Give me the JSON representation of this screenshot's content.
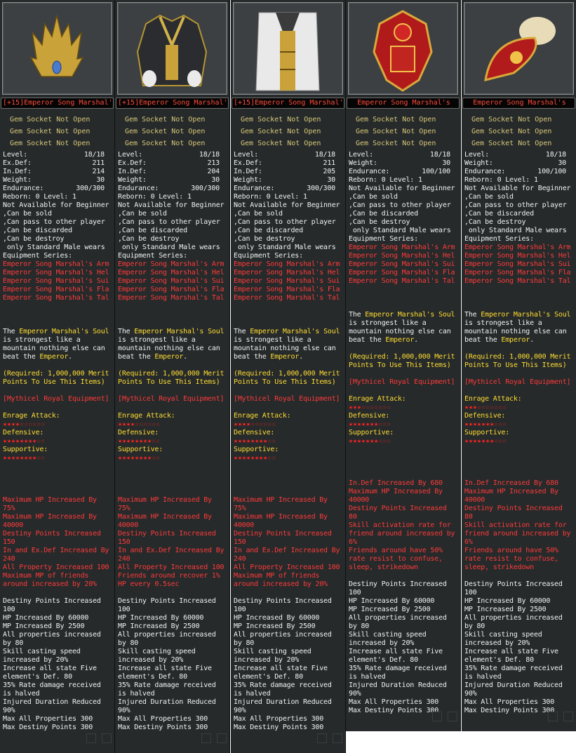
{
  "panels": [
    {
      "title": "[+15]Emperor Song Marshal's",
      "art_icon": "crown-icon",
      "gems": [
        "Gem Socket Not Open",
        "Gem Socket Not Open",
        "Gem Socket Not Open"
      ],
      "stats": [
        {
          "k": "Level:",
          "v": "18/18"
        },
        {
          "k": "Ex.Def:",
          "v": "211"
        },
        {
          "k": "In.Def:",
          "v": "214"
        },
        {
          "k": "Weight:",
          "v": "30"
        },
        {
          "k": "Endurance:",
          "v": "300/300"
        }
      ],
      "reborn": "Reborn: 0 Level: 1",
      "not_available": "Not Available for Beginner",
      "can_lines": [
        ",Can be sold",
        ",Can pass to other player",
        ",Can be discarded",
        ",Can be destroy",
        " only Standard Male wears"
      ],
      "series_label": "Equipment Series:",
      "series": [
        "Emperor Song Marshal's Arm",
        "Emperor Song Marshal's Hel",
        "Emperor Song Marshal's Sui",
        "Emperor Song Marshal's Fla",
        "Emperor Song Marshal's Tal"
      ],
      "desc": [
        {
          "t": "The ",
          "c": "w"
        },
        {
          "t": "Emperor Marshal's Soul",
          "c": "g"
        }
      ],
      "desc_lines": [
        "is strongest like a",
        "mountain nothing else can"
      ],
      "desc_last_a": "beat the ",
      "desc_last_b": "Emperor",
      "desc_last_c": ".",
      "required": [
        "(Required: 1,000,000 Merit",
        "Points To Use This Items)"
      ],
      "mythical": "[Mythicel Royal Equipment]",
      "enrage_label": "Enrage Attack:",
      "enrage_stars": "★★★★☆☆☆☆☆☆",
      "defensive_label": "Defensive:",
      "defensive_stars": "★★★★★★★★☆☆",
      "supportive_label": "Supportive:",
      "supportive_stars": "★★★★★★★★☆☆",
      "bonus": [
        "Maximum HP Increased By",
        "75%",
        "Maximum HP Increased By",
        "40000",
        "Destiny Points Increased",
        "150",
        "In and Ex.Def Increased By",
        "240",
        "All Property Increased 100",
        "Maximum MP of friends",
        "around increased by 20%"
      ],
      "set": [
        "Destiny Points Increased",
        "100",
        "HP Increased By 60000",
        "MP Increased By 2500",
        "All properties increased",
        "by 80",
        "Skill casting speed",
        "increased by 20%",
        "Increase all state Five",
        "element's Def. 80",
        "35% Rate damage received",
        "is halved",
        "Injured Duration Reduced",
        "90%",
        "Max All Properties 300",
        "Max Destiny Points 300"
      ]
    },
    {
      "title": "[+15]Emperor Song Marshal's",
      "art_icon": "armor-icon",
      "gems": [
        "Gem Socket Not Open",
        "Gem Socket Not Open",
        "Gem Socket Not Open"
      ],
      "stats": [
        {
          "k": "Level:",
          "v": "18/18"
        },
        {
          "k": "Ex.Def:",
          "v": "213"
        },
        {
          "k": "In.Def:",
          "v": "204"
        },
        {
          "k": "Weight:",
          "v": "30"
        },
        {
          "k": "Endurance:",
          "v": "300/300"
        }
      ],
      "reborn": "Reborn: 0 Level: 1",
      "not_available": "Not Available for Beginner",
      "can_lines": [
        ",Can be sold",
        ",Can pass to other player",
        ",Can be discarded",
        ",Can be destroy",
        " only Standard Male wears"
      ],
      "series_label": "Equipment Series:",
      "series": [
        "Emperor Song Marshal's Arm",
        "Emperor Song Marshal's Hel",
        "Emperor Song Marshal's Sui",
        "Emperor Song Marshal's Fla",
        "Emperor Song Marshal's Tal"
      ],
      "desc_lines": [
        "is strongest like a",
        "mountain nothing else can"
      ],
      "desc_last_a": "beat the ",
      "desc_last_b": "Emperor",
      "desc_last_c": ".",
      "required": [
        "(Required: 1,000,000 Merit",
        "Points To Use This Items)"
      ],
      "mythical": "[Mythicel Royal Equipment]",
      "enrage_label": "Enrage Attack:",
      "enrage_stars": "★★★★☆☆☆☆☆☆",
      "defensive_label": "Defensive:",
      "defensive_stars": "★★★★★★★★☆☆",
      "supportive_label": "Supportive:",
      "supportive_stars": "★★★★★★★★☆☆",
      "bonus": [
        "Maximum HP Increased By",
        "75%",
        "Maximum HP Increased By",
        "40000",
        "Destiny Points Increased",
        "150",
        "In and Ex.Def Increased By",
        "240",
        "All Property Increased 100",
        "Friends around recover 1%",
        "HP every 0.5sec"
      ],
      "set": [
        "Destiny Points Increased",
        "100",
        "HP Increased By 60000",
        "MP Increased By 2500",
        "All properties increased",
        "by 80",
        "Skill casting speed",
        "increased by 20%",
        "Increase all state Five",
        "element's Def. 80",
        "35% Rate damage received",
        "is halved",
        "Injured Duration Reduced",
        "90%",
        "Max All Properties 300",
        "Max Destiny Points 300"
      ]
    },
    {
      "title": "[+15]Emperor Song Marshal's",
      "art_icon": "robe-icon",
      "gems": [
        "Gem Socket Not Open",
        "Gem Socket Not Open",
        "Gem Socket Not Open"
      ],
      "stats": [
        {
          "k": "Level:",
          "v": "18/18"
        },
        {
          "k": "Ex.Def:",
          "v": "211"
        },
        {
          "k": "In.Def:",
          "v": "205"
        },
        {
          "k": "Weight:",
          "v": "30"
        },
        {
          "k": "Endurance:",
          "v": "300/300"
        }
      ],
      "reborn": "Reborn: 0 Level: 1",
      "not_available": "Not Available for Beginner",
      "can_lines": [
        ",Can be sold",
        ",Can pass to other player",
        ",Can be discarded",
        ",Can be destroy",
        " only Standard Male wears"
      ],
      "series_label": "Equipment Series:",
      "series": [
        "Emperor Song Marshal's Arm",
        "Emperor Song Marshal's Hel",
        "Emperor Song Marshal's Sui",
        "Emperor Song Marshal's Fla",
        "Emperor Song Marshal's Tal"
      ],
      "desc_lines": [
        "is strongest like a",
        "mountain nothing else can"
      ],
      "desc_last_a": "beat the ",
      "desc_last_b": "Emperor",
      "desc_last_c": ".",
      "required": [
        "(Required: 1,000,000 Merit",
        "Points To Use This Items)"
      ],
      "mythical": "[Mythicel Royal Equipment]",
      "enrage_label": "Enrage Attack:",
      "enrage_stars": "★★★★☆☆☆☆☆☆",
      "defensive_label": "Defensive:",
      "defensive_stars": "★★★★★★★★☆☆",
      "supportive_label": "Supportive:",
      "supportive_stars": "★★★★★★★★☆☆",
      "bonus": [
        "Maximum HP Increased By",
        "75%",
        "Maximum HP Increased By",
        "40000",
        "Destiny Points Increased",
        "150",
        "In and Ex.Def Increased By",
        "240",
        "All Property Increased 100",
        "Maximum MP of friends",
        "around increased by 20%"
      ],
      "set": [
        "Destiny Points Increased",
        "100",
        "HP Increased By 60000",
        "MP Increased By 2500",
        "All properties increased",
        "by 80",
        "Skill casting speed",
        "increased by 20%",
        "Increase all state Five",
        "element's Def. 80",
        "35% Rate damage received",
        "is halved",
        "Injured Duration Reduced",
        "90%",
        "Max All Properties 300",
        "Max Destiny Points 300"
      ]
    },
    {
      "title": "Emperor Song Marshal's",
      "art_icon": "amulet-icon",
      "gems": [
        "Gem Socket Not Open",
        "Gem Socket Not Open",
        "Gem Socket Not Open"
      ],
      "stats": [
        {
          "k": "Level:",
          "v": "18/18"
        },
        {
          "k": "Weight:",
          "v": "30"
        },
        {
          "k": "Endurance:",
          "v": "100/100"
        }
      ],
      "reborn": "Reborn: 0 Level: 1",
      "not_available": "Not Available for Beginner",
      "can_lines": [
        ",Can be sold",
        ",Can pass to other player",
        ",Can be discarded",
        ",Can be destroy",
        " only Standard Male wears"
      ],
      "series_label": "Equipment Series:",
      "series": [
        "Emperor Song Marshal's Arm",
        "Emperor Song Marshal's Hel",
        "Emperor Song Marshal's Sui",
        "Emperor Song Marshal's Fla",
        "Emperor Song Marshal's Tal"
      ],
      "desc_lines": [
        "is strongest like a",
        "mountain nothing else can"
      ],
      "desc_last_a": "beat the ",
      "desc_last_b": "Emperor",
      "desc_last_c": ".",
      "required": [
        "(Required: 1,000,000 Merit",
        "Points To Use This Items)"
      ],
      "mythical": "[Mythicel Royal Equipment]",
      "enrage_label": "Enrage Attack:",
      "enrage_stars": "★★★☆☆☆☆☆☆☆",
      "defensive_label": "Defensive:",
      "defensive_stars": "★★★★★★★☆☆☆",
      "supportive_label": "Supportive:",
      "supportive_stars": "★★★★★★★☆☆☆",
      "bonus": [
        "In.Def Increased By 680",
        "Maximum HP Increased By",
        "40000",
        "Destiny Points Increased",
        "80",
        "Skill activation rate for",
        "friend around increased by",
        "6%",
        "Friends around have 50%",
        "rate resist to confuse,",
        "sleep, strikedown"
      ],
      "set": [
        "Destiny Points Increased",
        "100",
        "HP Increased By 60000",
        "MP Increased By 2500",
        "All properties increased",
        "by 80",
        "Skill casting speed",
        "increased by 20%",
        "Increase all state Five",
        "element's Def. 80",
        "35% Rate damage received",
        "is halved",
        "Injured Duration Reduced",
        "90%",
        "Max All Properties 300",
        "Max Destiny Points 300"
      ]
    },
    {
      "title": "Emperor Song Marshal's",
      "art_icon": "gourd-icon",
      "gems": [
        "Gem Socket Not Open",
        "Gem Socket Not Open",
        "Gem Socket Not Open"
      ],
      "stats": [
        {
          "k": "Level:",
          "v": "18/18"
        },
        {
          "k": "Weight:",
          "v": "30"
        },
        {
          "k": "Endurance:",
          "v": "100/100"
        }
      ],
      "reborn": "Reborn: 0 Level: 1",
      "not_available": "Not Available for Beginner",
      "can_lines": [
        ",Can be sold",
        ",Can pass to other player",
        ",Can be discarded",
        ",Can be destroy",
        " only Standard Male wears"
      ],
      "series_label": "Equipment Series:",
      "series": [
        "Emperor Song Marshal's Arm",
        "Emperor Song Marshal's Hel",
        "Emperor Song Marshal's Sui",
        "Emperor Song Marshal's Fla",
        "Emperor Song Marshal's Tal"
      ],
      "desc_lines": [
        "is strongest like a",
        "mountain nothing else can"
      ],
      "desc_last_a": "beat the ",
      "desc_last_b": "Emperor",
      "desc_last_c": ".",
      "required": [
        "(Required: 1,000,000 Merit",
        "Points To Use This Items)"
      ],
      "mythical": "[Mythicel Royal Equipment]",
      "enrage_label": "Enrage Attack:",
      "enrage_stars": "★★★☆☆☆☆☆☆☆",
      "defensive_label": "Defensive:",
      "defensive_stars": "★★★★★★★☆☆☆",
      "supportive_label": "Supportive:",
      "supportive_stars": "★★★★★★★☆☆☆",
      "bonus": [
        "In.Def Increased By 680",
        "Maximum HP Increased By",
        "40000",
        "Destiny Points Increased",
        "80",
        "Skill activation rate for",
        "friend around increased by",
        "6%",
        "Friends around have 50%",
        "rate resist to confuse,",
        "sleep, strikedown"
      ],
      "set": [
        "Destiny Points Increased",
        "100",
        "HP Increased By 60000",
        "MP Increased By 2500",
        "All properties increased",
        "by 80",
        "Skill casting speed",
        "increased by 20%",
        "Increase all state Five",
        "element's Def. 80",
        "35% Rate damage received",
        "is halved",
        "Injured Duration Reduced",
        "90%",
        "Max All Properties 300",
        "Max Destiny Points 300"
      ]
    }
  ],
  "desc_first_a": "The ",
  "desc_first_b": "Emperor Marshal's Soul"
}
